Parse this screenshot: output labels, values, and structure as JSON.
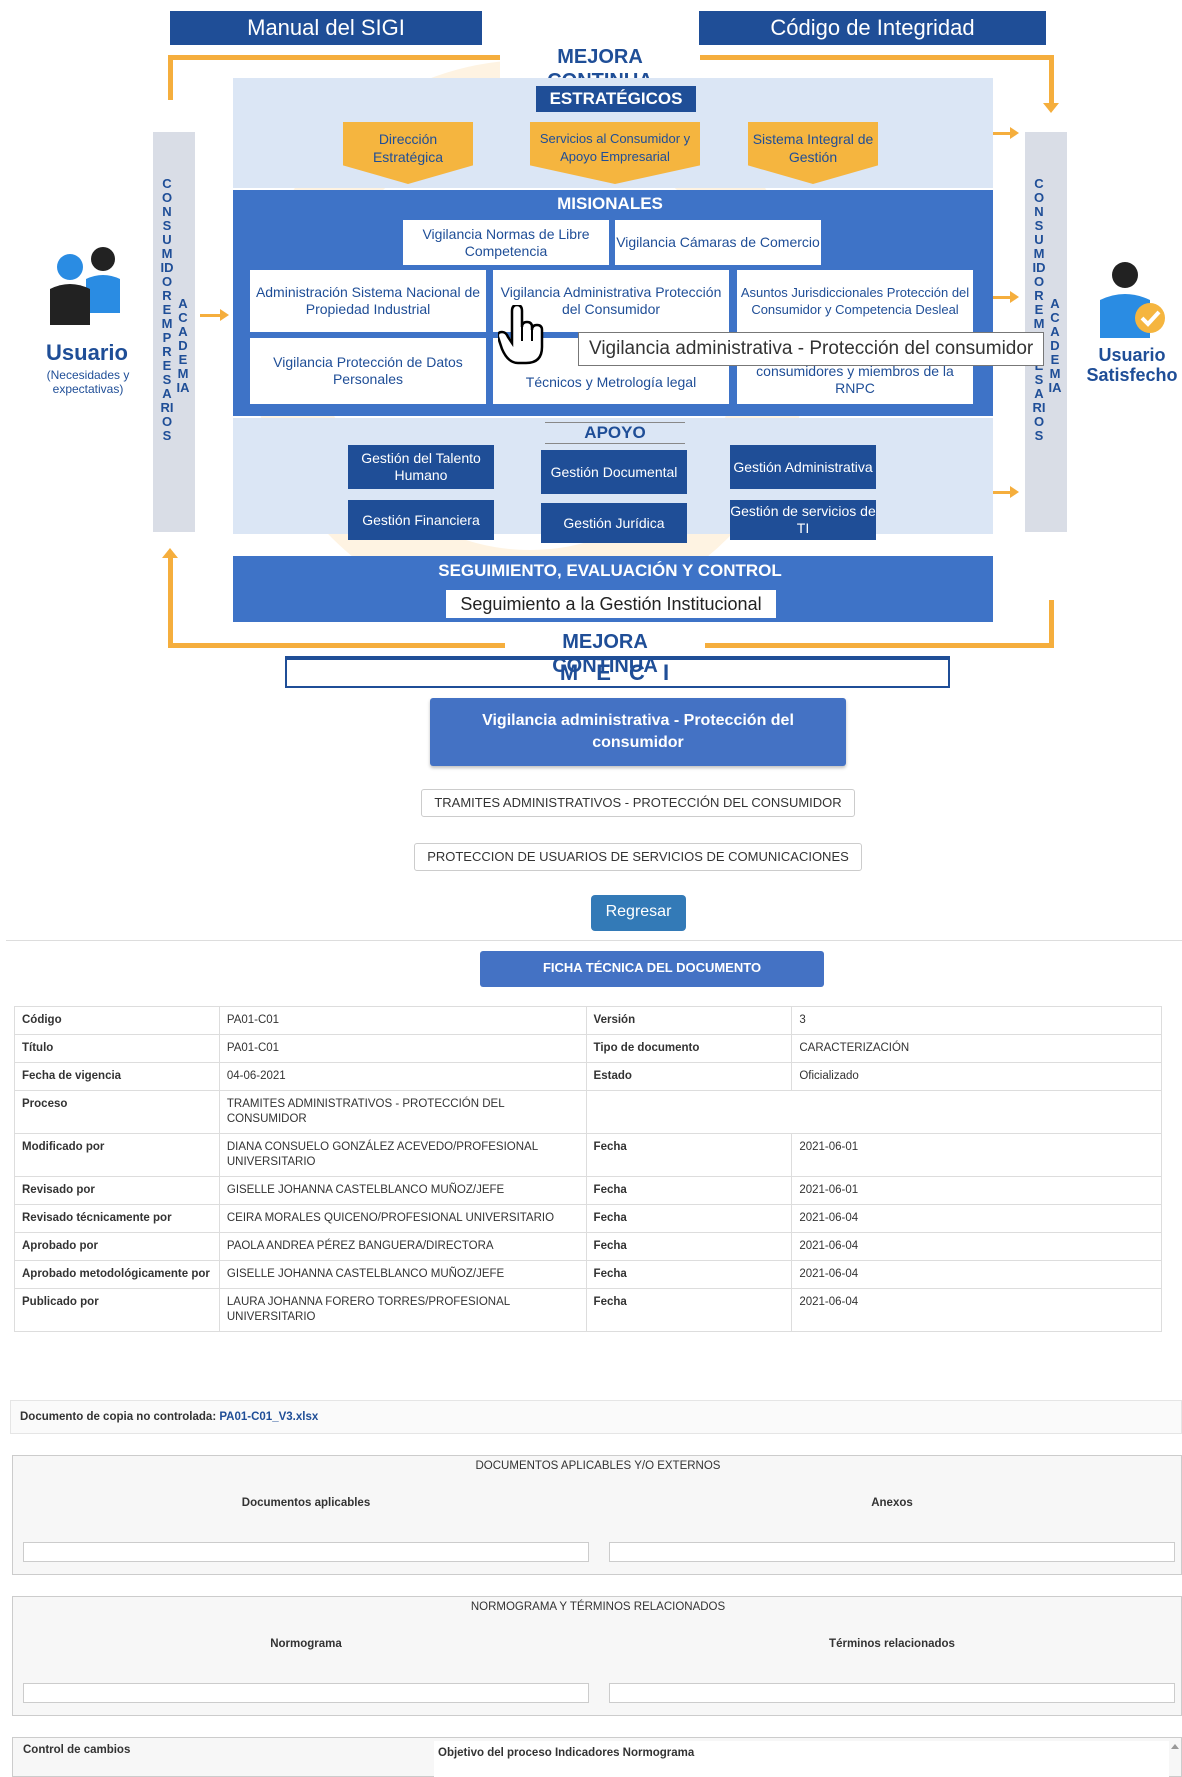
{
  "map": {
    "manual_label": "Manual del SIGI",
    "codigo_label": "Código de Integridad",
    "mejora_top": "MEJORA CONTINUA",
    "mejora_bottom": "MEJORA CONTINUA",
    "left_side_text": "CONSUMIDOR EMPRESARIOS",
    "left_side_text2": "ACADEMIA",
    "right_side_text": "CONSUMIDOR EMPRESARIOS",
    "right_side_text2": "ACADEMIA",
    "estrategicos_title": "ESTRATÉGICOS",
    "estrategicos": [
      "Dirección Estratégica",
      "Servicios al Consumidor y Apoyo Empresarial",
      "Sistema Integral de Gestión"
    ],
    "misionales_title": "MISIONALES",
    "misionales_top": [
      "Vigilancia Normas de Libre Competencia",
      "Vigilancia Cámaras de Comercio"
    ],
    "misionales_row1": [
      "Administración Sistema Nacional de Propiedad Industrial",
      "Vigilancia Administrativa Protección del Consumidor",
      "Asuntos Jurisdiccionales Protección del Consumidor y Competencia Desleal"
    ],
    "misionales_row2": [
      "Vigilancia Protección de Datos Personales",
      "Técnicos y Metrología legal",
      "consumidores y miembros de la RNPC"
    ],
    "apoyo_title": "APOYO",
    "apoyo": [
      "Gestión del Talento Humano",
      "Gestión Documental",
      "Gestión Administrativa",
      "Gestión Financiera",
      "Gestión Jurídica",
      "Gestión de servicios de TI"
    ],
    "seguimiento_title": "SEGUIMIENTO, EVALUACIÓN Y CONTROL",
    "seguimiento_box": "Seguimiento a la Gestión Institucional",
    "meci": "M E C I",
    "user_left": "Usuario",
    "user_left_sub": "(Necesidades y expectativas)",
    "user_right": "Usuario Satisfecho",
    "tooltip": "Vigilancia administrativa - Protección del consumidor"
  },
  "selected_process_button": "Vigilancia administrativa - Protección del consumidor",
  "sub_buttons": [
    "TRAMITES ADMINISTRATIVOS - PROTECCIÓN DEL CONSUMIDOR",
    "PROTECCION DE USUARIOS DE SERVICIOS DE COMUNICACIONES"
  ],
  "back_button": "Regresar",
  "ficha_button": "FICHA TÉCNICA DEL DOCUMENTO",
  "ficha": {
    "codigo_label": "Código",
    "codigo": "PA01-C01",
    "version_label": "Versión",
    "version": "3",
    "titulo_label": "Título",
    "titulo": "PA01-C01",
    "tipo_label": "Tipo de documento",
    "tipo": "CARACTERIZACIÓN",
    "fecha_vig_label": "Fecha de vigencia",
    "fecha_vig": "04-06-2021",
    "estado_label": "Estado",
    "estado": "Oficializado",
    "proceso_label": "Proceso",
    "proceso": "TRAMITES ADMINISTRATIVOS - PROTECCIÓN DEL CONSUMIDOR",
    "fecha_label": "Fecha",
    "rows": [
      {
        "label": "Modificado por",
        "value": "DIANA CONSUELO GONZÁLEZ ACEVEDO/PROFESIONAL UNIVERSITARIO",
        "date": "2021-06-01"
      },
      {
        "label": "Revisado por",
        "value": "GISELLE JOHANNA CASTELBLANCO MUÑOZ/JEFE",
        "date": "2021-06-01"
      },
      {
        "label": "Revisado técnicamente por",
        "value": "CEIRA MORALES QUICENO/PROFESIONAL UNIVERSITARIO",
        "date": "2021-06-04"
      },
      {
        "label": "Aprobado por",
        "value": "PAOLA ANDREA PÉREZ BANGUERA/DIRECTORA",
        "date": "2021-06-04"
      },
      {
        "label": "Aprobado metodológicamente por",
        "value": "GISELLE JOHANNA CASTELBLANCO MUÑOZ/JEFE",
        "date": "2021-06-04"
      },
      {
        "label": "Publicado por",
        "value": "LAURA JOHANNA FORERO TORRES/PROFESIONAL UNIVERSITARIO",
        "date": "2021-06-04"
      }
    ]
  },
  "copia_label": "Documento de copia no controlada:",
  "copia_link": "PA01-C01_V3.xlsx",
  "docs_panel": {
    "title": "DOCUMENTOS APLICABLES Y/O EXTERNOS",
    "col1": "Documentos aplicables",
    "col2": "Anexos"
  },
  "norm_panel": {
    "title": "NORMOGRAMA Y TÉRMINOS RELACIONADOS",
    "col1": "Normograma",
    "col2": "Términos relacionados"
  },
  "control_label": "Control de cambios",
  "control_tabs": "Objetivo del proceso Indicadores Normograma"
}
